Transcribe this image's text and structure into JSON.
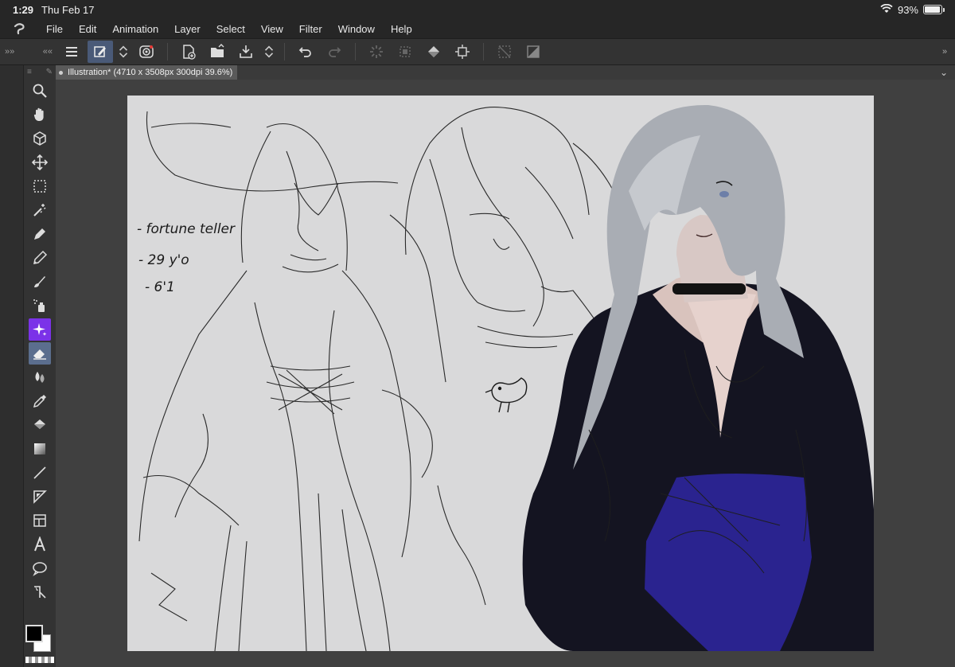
{
  "status_bar": {
    "time": "1:29",
    "date": "Thu Feb 17",
    "battery": "93%",
    "battery_level": 0.93
  },
  "menu": {
    "items": [
      "File",
      "Edit",
      "Animation",
      "Layer",
      "Select",
      "View",
      "Filter",
      "Window",
      "Help"
    ]
  },
  "command_bar": {
    "icons": [
      "menu-icon",
      "quick-access-icon",
      "up-down-icon",
      "spiral-icon",
      "new-file-icon",
      "open-folder-icon",
      "save-icon",
      "up-down-icon",
      "undo-icon",
      "redo-icon",
      "loading-icon",
      "selection-icon",
      "fill-icon",
      "transform-icon",
      "deselect-icon",
      "invert-selection-icon"
    ]
  },
  "document_tab": {
    "title": "Illustration* (4710 x 3508px 300dpi 39.6%)"
  },
  "tools": [
    "zoom-icon",
    "hand-icon",
    "3d-object-icon",
    "move-icon",
    "selection-rectangle-icon",
    "magic-wand-icon",
    "pen-icon",
    "pencil-icon",
    "brush-icon",
    "airbrush-icon",
    "decoration-icon",
    "eraser-icon",
    "blend-icon",
    "eyedropper-icon",
    "fill-icon",
    "gradient-icon",
    "line-icon",
    "ruler-icon",
    "frame-icon",
    "text-icon",
    "balloon-icon",
    "correct-line-icon"
  ],
  "canvas_notes": [
    "- fortune teller",
    "- 29 y'o",
    "- 6'1"
  ],
  "colors": {
    "main": "#000000",
    "sub": "#ffffff",
    "accent_active_tool": "#5b6e8e",
    "accent_purple_tool": "#7b32e8",
    "corset_blue": "#2a238f"
  }
}
